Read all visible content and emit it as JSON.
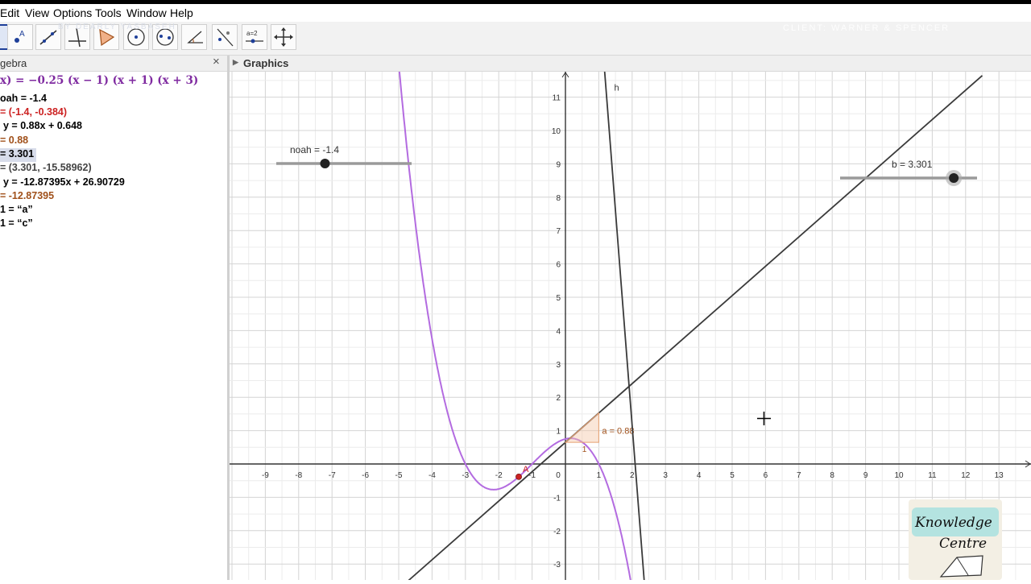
{
  "menu": [
    "Edit",
    "View",
    "Options",
    "Tools",
    "Window",
    "Help"
  ],
  "toolbar": {
    "tools": [
      "move-tool",
      "point-tool",
      "line-tool",
      "perpendicular-line-tool",
      "polygon-tool",
      "circle-tool",
      "conic-tool",
      "angle-tool",
      "reflect-tool",
      "slider-tool",
      "move-graphics-view-tool"
    ],
    "slider_tool_label": "a=2",
    "watermark_left": "BY DEARLY YASBASEH",
    "watermark_right": "CLIENT: WARNER & SPENCER"
  },
  "algebra": {
    "title": "gebra",
    "rows": [
      {
        "text": "x) = −0.25 (x − 1) (x + 1) (x + 3)",
        "color": "#7f2aa0",
        "serif": true
      },
      {
        "text": "oah = -1.4",
        "color": "#000000"
      },
      {
        "text": "= (-1.4, -0.384)",
        "color": "#cc2222"
      },
      {
        "text": "y = 0.88x + 0.648",
        "color": "#000000"
      },
      {
        "text": "= 0.88",
        "color": "#a0501a"
      },
      {
        "text": "= 3.301",
        "color": "#000000",
        "highlight": true
      },
      {
        "text": "= (3.301, -15.58962)",
        "color": "#444444"
      },
      {
        "text": "y = -12.87395x + 26.90729",
        "color": "#000000"
      },
      {
        "text": "= -12.87395",
        "color": "#a0501a"
      },
      {
        "text": "1 = “a”",
        "color": "#000000"
      },
      {
        "text": "1 = “c”",
        "color": "#000000"
      }
    ]
  },
  "graphics": {
    "title": "Graphics",
    "function": {
      "a": -0.25,
      "roots": [
        1,
        -1,
        -3
      ],
      "color": "#b36be0"
    },
    "tangent": {
      "slope": 0.88,
      "intercept": 0.648,
      "color": "#3a3a3a"
    },
    "line_h": {
      "slope": -12.87395,
      "intercept": 26.90729,
      "label": "h",
      "color": "#3a3a3a"
    },
    "point_A": {
      "x": -1.4,
      "y": -0.384,
      "label": "A",
      "color": "#cc2222"
    },
    "slope_triangle_label": "a = 0.88",
    "slope_triangle_run_label": "1",
    "slider_noah": {
      "label": "noah = -1.4",
      "value": -1.4,
      "min": -5,
      "max": 5
    },
    "slider_b": {
      "label": "b = 3.301",
      "value": 3.301,
      "min": -5,
      "max": 5
    },
    "x_ticks": [
      "-9",
      "-8",
      "-7",
      "-6",
      "-5",
      "-4",
      "-3",
      "-2",
      "-1",
      "0",
      "1",
      "2",
      "3",
      "4",
      "5",
      "6",
      "7",
      "8",
      "9",
      "10",
      "11",
      "12",
      "13"
    ],
    "y_ticks": [
      "11",
      "10",
      "9",
      "8",
      "7",
      "6",
      "5",
      "4",
      "3",
      "2",
      "1",
      "-1",
      "-2",
      "-3"
    ],
    "axes_color": "#333333",
    "grid": true
  },
  "logo": {
    "line1": "Knowledge",
    "line2": "Centre"
  }
}
